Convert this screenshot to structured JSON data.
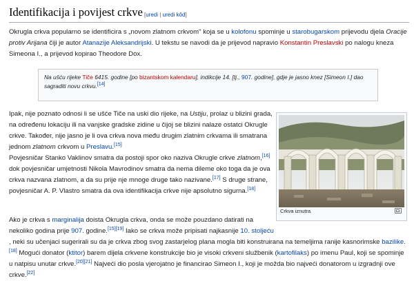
{
  "heading": {
    "title": "Identifikacija i povijest crkve",
    "edit_open": "[",
    "edit": "uredi",
    "edit_sep": " | ",
    "edit_code": "uredi kôd",
    "edit_close": "]"
  },
  "p1": {
    "t1": "Okrugla crkva popularno se identificira s „novom zlatnom crkvom\" koja se u ",
    "l1": "kolofonu",
    "t2": " spominje u ",
    "l2": "starobugarskom",
    "t3": " prijevodu djela ",
    "i1": "Oracije protiv Arijana",
    "t4": " čiji je autor ",
    "l3": "Atanazije Aleksandrijski",
    "t5": ". U tekstu se navodi da je prijevod napravio ",
    "l4": "Konstantin Preslavski",
    "t6": " po nalogu kneza Simeona I., a prijevod kopirao Theodore Dox."
  },
  "quote": {
    "t1": "Na ušću rijeke ",
    "l1": "Tiče",
    "t2": " 6415. godine [po ",
    "l2": "bizantskom kalendaru",
    "t3": "], indikcije 14. [tj., ",
    "l3": "907",
    "t4": ". godine], gdje je jasno knez [Simeon I.] dao sagraditi novu crkvu.",
    "ref": "[14]"
  },
  "p2": {
    "t1": "Ipak, nije poznato odnosi li se ušće Tiče na uski dio rijeke, na ",
    "i1": "Ustiju",
    "t2": ", prolaz u blizini grada, na određenu lokaciju ili na vanjske gradske zidine u čijoj se blizini nalaze ostatci Okrugle crkve. Također, nije jasno je li ova crkva nova među drugim zlatnim crkvama ili smatrana jednom ",
    "i2": "zlatnom",
    "t3": " crkvom u ",
    "l1": "Preslavu",
    "t4": ".",
    "r1": "[15]"
  },
  "p2b": {
    "t1": "Povjesničar Stanko Vaklinov smatra da postoji spor oko naziva Okrugle crkve ",
    "i1": "zlatnom",
    "t2": ",",
    "r1": "[16]",
    "t3": " dok povjesničar umjetnosti Nikola Mavrodinov smatra da nema dileme oko toga da je ova crkva nazvana zlatnom, a da su prije nje mnoge druge tako nazivane.",
    "r2": "[17]",
    "t4": " S druge strane, povjesničar A. P. Vlastro smatra da ova identifikacija crkve nije apsolutno sigurna.",
    "r3": "[18]"
  },
  "figure": {
    "caption": "Crkva iznutra",
    "enlarge_icon": "enlarge-icon"
  },
  "p3": {
    "t1": "Ako je crkva s ",
    "l1": "marginalija",
    "t2": " doista Okrugla crkva, onda se može pouzdano datirati na nekoliko godina prije ",
    "l2": "907",
    "t3": ". godine.",
    "r1": "[15][19]",
    "t4": " Iako se crkva može pripisati najkasnije ",
    "l3": "10. stoljeću",
    "t5": ", neki su učenjaci sugerirali su da je crkva zbog svog zastarjelog plana mogla biti konstruirana na temeljima ranije kasnorimske ",
    "l4": "bazilike",
    "t6": ".",
    "r2": "[18]",
    "t7": " Mogući donator (",
    "l5": "ktitor",
    "t8": ") barem dijela crkvene konstrukcije bio je visoki crkveni službenik (",
    "l6": "kartofilaks",
    "t9": ") po imenu Paul, koji se spominje u natpisu unutar crkve.",
    "r3": "[20][21]",
    "t10": " Najveći dio posla vjerojatno je financirao Simeon I., koji je možda bio najveći donatorom u izgradnji ove crkve.",
    "r4": "[22]"
  }
}
